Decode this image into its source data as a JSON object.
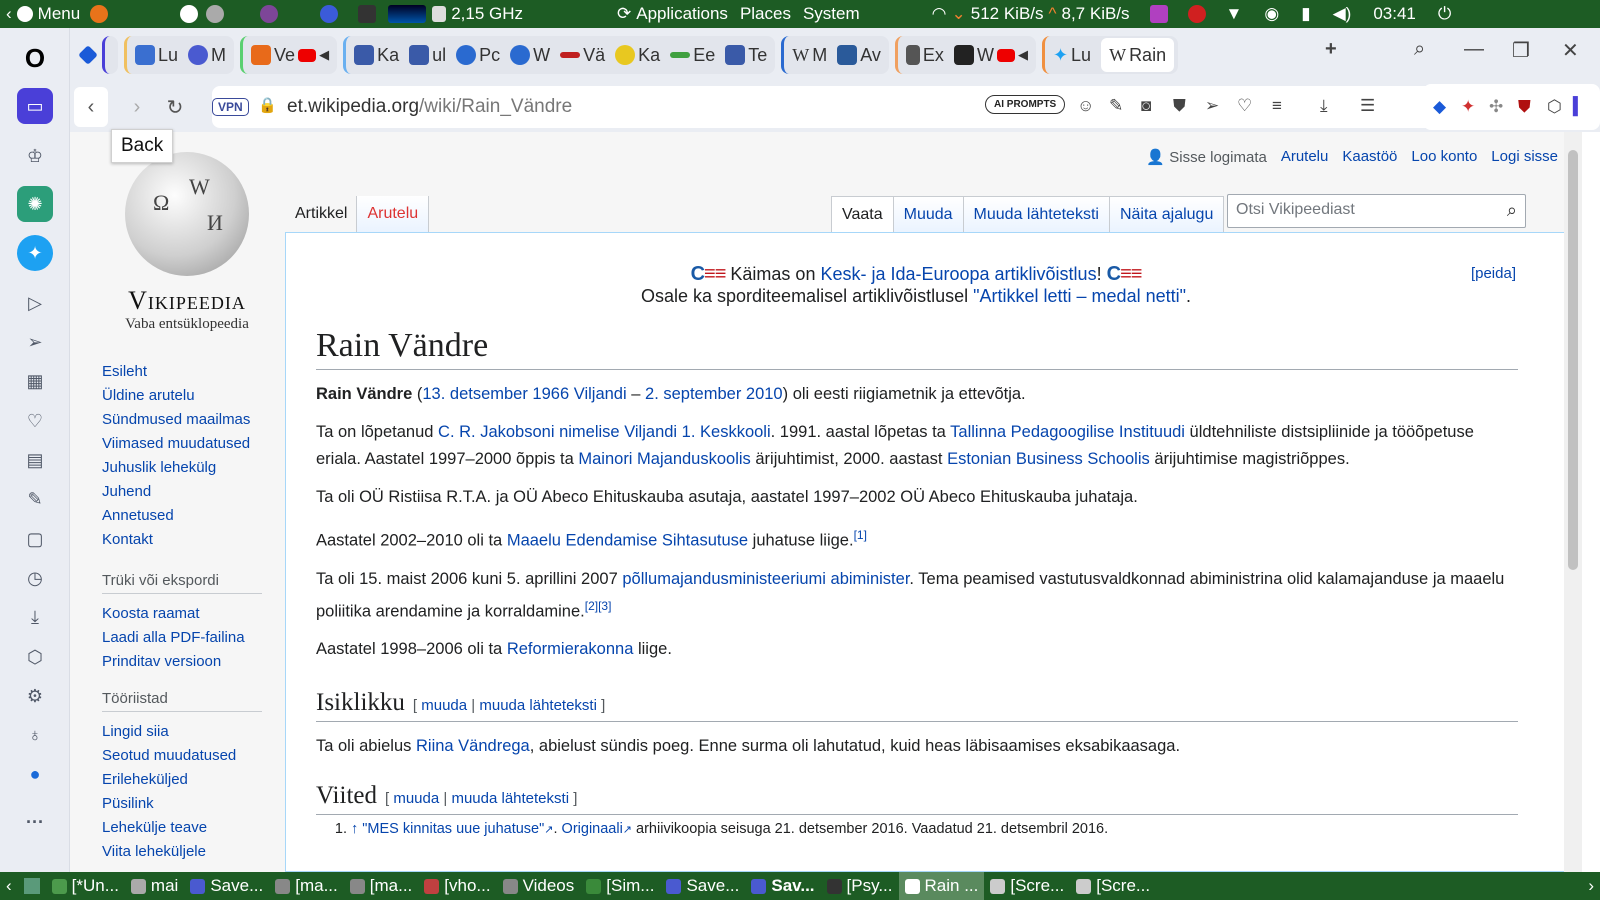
{
  "system_panel": {
    "menu_label": "Menu",
    "cpu_freq": "2,15 GHz",
    "menus": [
      "Applications",
      "Places",
      "System"
    ],
    "net_down": "512 KiB/s",
    "net_up": "8,7 KiB/s",
    "clock": "03:41"
  },
  "tabs": [
    {
      "label": "Lu",
      "color": "#3a6fd0"
    },
    {
      "label": "M",
      "color": "#4a5ad0"
    },
    {
      "label": "Ve",
      "color": "#e86a1a"
    },
    {
      "label": "Ka",
      "color": "#3a5aa8"
    },
    {
      "label": "ul",
      "color": "#3a5aa8"
    },
    {
      "label": "Pc",
      "color": "#2a6ad0"
    },
    {
      "label": "W",
      "color": "#2a6ad0"
    },
    {
      "label": "Vä",
      "color": "#c02020"
    },
    {
      "label": "Ka",
      "color": "#e8c820"
    },
    {
      "label": "Ee",
      "color": "#40a040"
    },
    {
      "label": "Te",
      "color": "#3a5aa8"
    },
    {
      "label": "M",
      "color": "#222222"
    },
    {
      "label": "Av",
      "color": "#2a5a9a"
    },
    {
      "label": "Ex",
      "color": "#555555"
    },
    {
      "label": "W",
      "color": "#222222"
    },
    {
      "label": "Lu",
      "color": "#1da1f2"
    }
  ],
  "active_tab": {
    "label": "Rain"
  },
  "address_bar": {
    "vpn": "VPN",
    "url_domain": "et.wikipedia.org",
    "url_path": "/wiki/Rain_Vändre",
    "ai_prompts": "AI PROMPTS"
  },
  "tooltip": "Back",
  "wiki": {
    "logo_title": "Vikipeedia",
    "logo_subtitle": "Vaba entsüklopeedia",
    "personal": [
      "Sisse logimata",
      "Arutelu",
      "Kaastöö",
      "Loo konto",
      "Logi sisse"
    ],
    "ns_tabs": [
      "Artikkel",
      "Arutelu"
    ],
    "view_tabs": [
      "Vaata",
      "Muuda",
      "Muuda lähteteksti",
      "Näita ajalugu"
    ],
    "search_placeholder": "Otsi Vikipeediast",
    "nav": [
      "Esileht",
      "Üldine arutelu",
      "Sündmused maailmas",
      "Viimased muudatused",
      "Juhuslik lehekülg",
      "Juhend",
      "Annetused",
      "Kontakt"
    ],
    "print_title": "Trüki või ekspordi",
    "print": [
      "Koosta raamat",
      "Laadi alla PDF-failina",
      "Prinditav versioon"
    ],
    "tools_title": "Tööriistad",
    "tools": [
      "Lingid siia",
      "Seotud muudatused",
      "Erileheküljed",
      "Püsilink",
      "Lehekülje teave",
      "Viita leheküljele"
    ],
    "notice_pre": "Käimas on ",
    "notice_link": "Kesk- ja Ida-Euroopa artiklivõistlus",
    "notice_post": "!",
    "notice2_pre": "Osale ka spordi­teemalisel artiklivõistlusel ",
    "notice2_link": "\"Artikkel letti – medal netti\"",
    "notice2_post": ".",
    "hide": "[peida]",
    "title": "Rain Vändre",
    "lead_bold": "Rain Vändre",
    "lead_date1": "13. detsember 1966",
    "lead_place": "Viljandi",
    "lead_date2": "2. september 2010",
    "lead_tail": ") oli eesti riigiametnik ja ettevõtja.",
    "p2_a": "Ta on lõpetanud ",
    "p2_l1": "C. R. Jakobsoni nimelise Viljandi 1. Keskkooli",
    "p2_b": ". 1991. aastal lõpetas ta ",
    "p2_l2": "Tallinna Pedagoogilise Instituudi",
    "p2_c": " üldtehniliste distsipliinide ja tööõpetuse eriala. Aastatel 1997–2000 õppis ta ",
    "p2_l3": "Mainori Majanduskoolis",
    "p2_d": " ärijuhtimist, 2000. aastast ",
    "p2_l4": "Estonian Business Schoolis",
    "p2_e": " ärijuhtimise magistriõppes.",
    "p3": "Ta oli OÜ Ristiisa R.T.A. ja OÜ Abeco Ehituskauba asutaja, aastatel 1997–2002 OÜ Abeco Ehituskauba juhataja.",
    "p4_a": "Aastatel 2002–2010 oli ta ",
    "p4_l": "Maaelu Edendamise Sihtasutuse",
    "p4_b": " juhatuse liige.",
    "p4_ref": "[1]",
    "p5_a": "Ta oli 15. maist 2006 kuni 5. aprillini 2007 ",
    "p5_l": "põllumajandusministeeriumi abiminister",
    "p5_b": ". Tema peamised vastutusvaldkonnad abiministrina olid kalamajanduse ja maaelu poliitika arendamine ja korraldamine.",
    "p5_ref": "[2][3]",
    "p6_a": "Aastatel 1998–2006 oli ta ",
    "p6_l": "Reformierakonna",
    "p6_b": " liige.",
    "h2_1": "Isiklikku",
    "edit": "muuda",
    "edit_src": "muuda lähteteksti",
    "p7_a": "Ta oli abielus ",
    "p7_l": "Riina Vändrega",
    "p7_b": ", abielust sündis poeg. Enne surma oli lahutatud, kuid heas läbisaamises eksabikaasaga.",
    "h2_2": "Viited",
    "ref1_link": "\"MES kinnitas uue juhatuse\"",
    "ref1_orig": "Originaali",
    "ref1_tail": " arhiivikoopia seisuga 21. detsember 2016. Vaadatud 21. detsembril 2016."
  },
  "taskbar": [
    "[*Un...",
    "mai",
    "Save...",
    "[ma...",
    "[ma...",
    "[vho...",
    "Videos",
    "[Sim...",
    "Save...",
    "Sav...",
    "[Psy...",
    "Rain ...",
    "[Scre...",
    "[Scre..."
  ]
}
